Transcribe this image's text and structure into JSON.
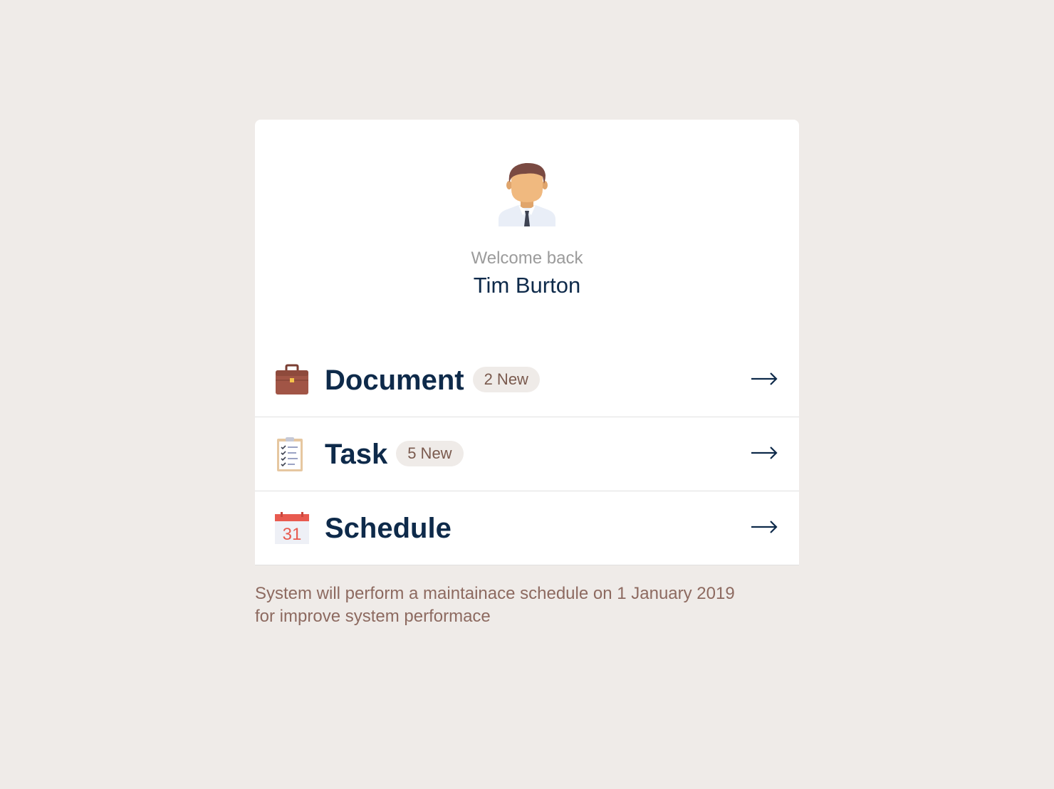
{
  "profile": {
    "welcome_text": "Welcome back",
    "name": "Tim Burton",
    "avatar_icon": "businessman-avatar-icon"
  },
  "menu": {
    "items": [
      {
        "label": "Document",
        "badge": "2 New",
        "icon": "briefcase-icon"
      },
      {
        "label": "Task",
        "badge": "5 New",
        "icon": "clipboard-checklist-icon"
      },
      {
        "label": "Schedule",
        "badge": "",
        "icon": "calendar-icon",
        "icon_text": "31"
      }
    ]
  },
  "notice": {
    "line1": "System will perform a maintainace schedule on 1 January 2019",
    "line2": "for improve system performace"
  },
  "colors": {
    "background": "#EFEBE8",
    "card": "#FFFFFF",
    "title": "#0E2A4A",
    "subtle": "#9B9B9B",
    "badge_bg": "#EFEBE8",
    "badge_text": "#7A5A4E",
    "notice_text": "#8D6A60"
  }
}
